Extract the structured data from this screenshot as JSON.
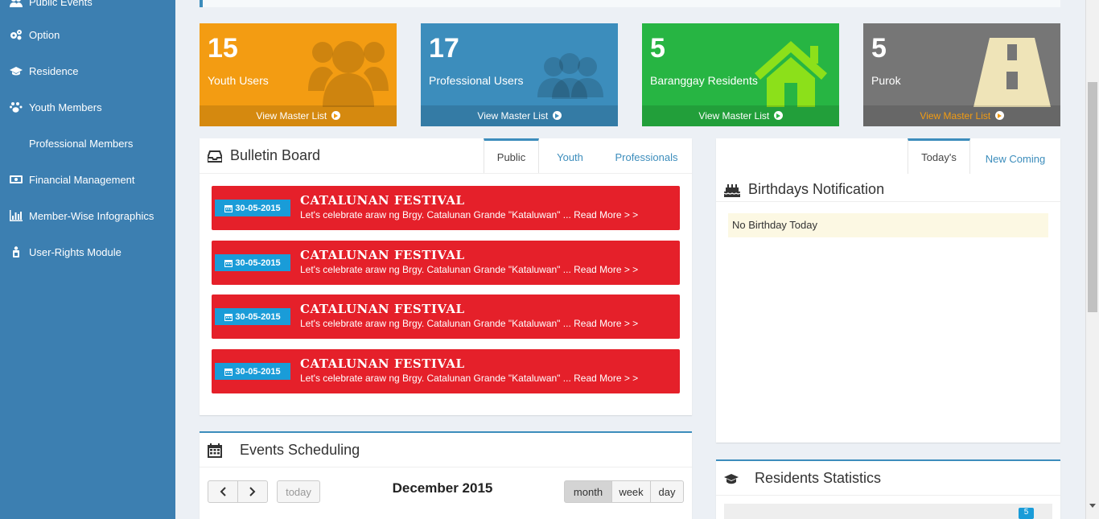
{
  "sidebar": {
    "items": [
      {
        "label": "Public Events",
        "icon": "users-icon"
      },
      {
        "label": "Option",
        "icon": "cogs-icon"
      },
      {
        "label": "Residence",
        "icon": "graduation-cap-icon"
      },
      {
        "label": "Youth Members",
        "icon": "paw-icon"
      },
      {
        "label": "Professional Members",
        "icon": ""
      },
      {
        "label": "Financial Management",
        "icon": "money-icon"
      },
      {
        "label": "Member-Wise Infographics",
        "icon": "bar-chart-icon"
      },
      {
        "label": "User-Rights Module",
        "icon": "child-icon"
      }
    ]
  },
  "stats": [
    {
      "value": "15",
      "label": "Youth Users",
      "link": "View Master List",
      "color": "#f39c12",
      "icon": "users-icon"
    },
    {
      "value": "17",
      "label": "Professional Users",
      "link": "View Master List",
      "color": "#3c8dbc",
      "icon": "group-icon"
    },
    {
      "value": "5",
      "label": "Baranggay Residents",
      "link": "View Master List",
      "color": "#27b543",
      "icon": "home-icon"
    },
    {
      "value": "5",
      "label": "Purok",
      "link": "View Master List",
      "color": "#767676",
      "icon": "road-icon"
    }
  ],
  "bulletin": {
    "title": "Bulletin Board",
    "tabs": [
      "Public",
      "Youth",
      "Professionals"
    ],
    "items": [
      {
        "date": "30-05-2015",
        "title": "CATALUNAN FESTIVAL",
        "desc": "Let's celebrate araw ng Brgy. Catalunan Grande \"Kataluwan\" ...",
        "more": "Read More > >"
      },
      {
        "date": "30-05-2015",
        "title": "CATALUNAN FESTIVAL",
        "desc": "Let's celebrate araw ng Brgy. Catalunan Grande \"Kataluwan\" ...",
        "more": "Read More > >"
      },
      {
        "date": "30-05-2015",
        "title": "CATALUNAN FESTIVAL",
        "desc": "Let's celebrate araw ng Brgy. Catalunan Grande \"Kataluwan\" ...",
        "more": "Read More > >"
      },
      {
        "date": "30-05-2015",
        "title": "CATALUNAN FESTIVAL",
        "desc": "Let's celebrate araw ng Brgy. Catalunan Grande \"Kataluwan\" ...",
        "more": "Read More > >"
      }
    ]
  },
  "birthdays": {
    "tabs": [
      "Today's",
      "New Coming"
    ],
    "title": "Birthdays Notification",
    "empty": "No Birthday Today"
  },
  "events": {
    "title": "Events Scheduling",
    "today": "today",
    "month_label": "December 2015",
    "views": [
      "month",
      "week",
      "day"
    ]
  },
  "residents": {
    "title": "Residents Statistics",
    "badge": "5"
  }
}
